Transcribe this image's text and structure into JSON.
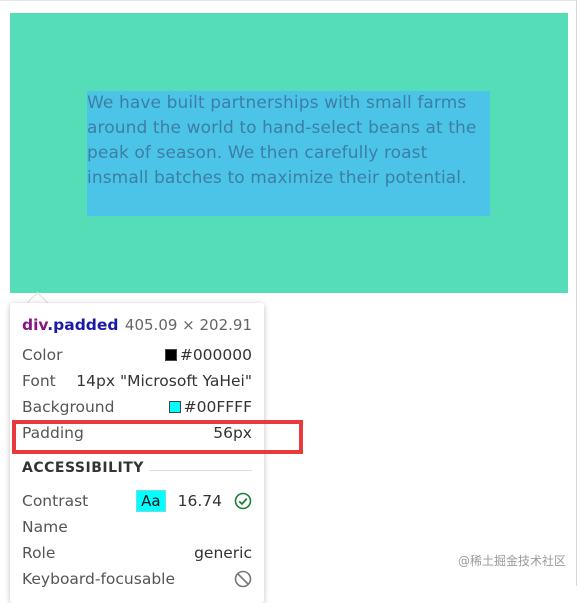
{
  "page": {
    "paragraph": "We have built partnerships with small farms around the world to hand-select beans at the peak of season. We then carefully roast insmall batches to maximize their potential."
  },
  "tooltip": {
    "tag": "div",
    "class_name": ".padded",
    "dimensions": "405.09 × 202.91",
    "rows": [
      {
        "label": "Color",
        "value": "#000000",
        "swatch": "#000000"
      },
      {
        "label": "Font",
        "value": "14px \"Microsoft YaHei\""
      },
      {
        "label": "Background",
        "value": "#00FFFF",
        "swatch": "#00FFFF"
      },
      {
        "label": "Padding",
        "value": "56px"
      }
    ],
    "accessibility": {
      "title": "ACCESSIBILITY",
      "contrast_label": "Contrast",
      "contrast_chip": "Aa",
      "contrast_value": "16.74",
      "name_label": "Name",
      "role_label": "Role",
      "role_value": "generic",
      "keyboard_label": "Keyboard-focusable"
    }
  },
  "icons": {
    "pass": "check-circle-icon",
    "not_focusable": "no-entry-icon"
  },
  "colors": {
    "padding_overlay": "#55ddb8",
    "content_overlay": "#4cc4e8",
    "highlight": "#e83a3a"
  },
  "watermark": "@稀土掘金技术社区"
}
